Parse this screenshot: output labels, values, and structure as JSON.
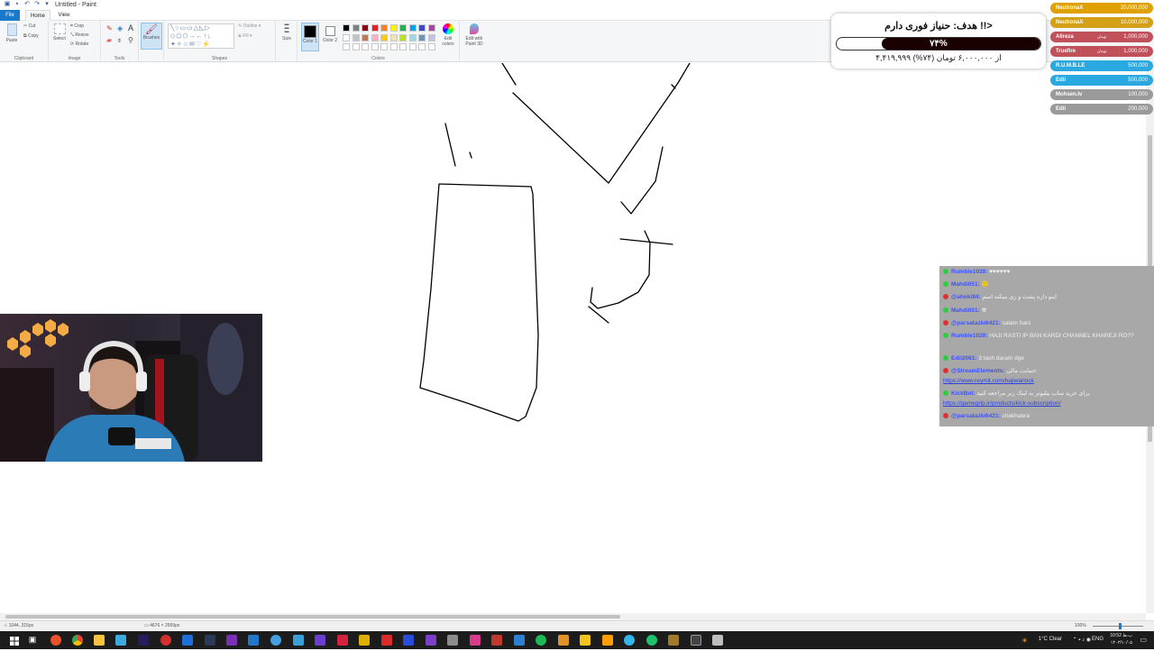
{
  "window": {
    "title": "Untitled - Paint"
  },
  "tabs": [
    {
      "label": "File"
    },
    {
      "label": "Home"
    },
    {
      "label": "View"
    }
  ],
  "ribbon": {
    "groups": [
      {
        "name": "Clipboard"
      },
      {
        "name": "Image"
      },
      {
        "name": "Tools"
      },
      {
        "name": "Shapes"
      },
      {
        "name": "Colors"
      }
    ],
    "buttons": {
      "paste": "Paste",
      "cut": "Cut",
      "copy": "Copy",
      "select": "Select",
      "crop": "Crop",
      "resize": "Resize",
      "rotate": "Rotate",
      "brushes": "Brushes",
      "outline": "Outline",
      "fill": "Fill",
      "size": "Size",
      "color1": "Color 1",
      "color2": "Color 2",
      "edit_colors": "Edit colors",
      "edit_paint3d": "Edit with Paint 3D"
    },
    "palette": [
      "#000000",
      "#7f7f7f",
      "#880015",
      "#ed1c24",
      "#ff7f27",
      "#fff200",
      "#22b14c",
      "#00a2e8",
      "#3f48cc",
      "#a349a4",
      "#ffffff",
      "#c3c3c3",
      "#b97a57",
      "#ffaec9",
      "#ffc90e",
      "#efe4b0",
      "#b5e61d",
      "#99d9ea",
      "#7092be",
      "#c8bfe7"
    ],
    "color1": "#000000",
    "color2": "#ffffff"
  },
  "status": {
    "position": "1044, 315px",
    "canvas_size": "4676 × 2569px",
    "zoom": "100%"
  },
  "tray": {
    "weather": "1°C  Clear",
    "lang": "ENG",
    "time": "10:52 ب.ظ",
    "date": "۱۴۰۳/۱۰/۰۵"
  },
  "donation_goal": {
    "title": "هدف: حنیاز فوری دارم !!>",
    "percent_label": "۷۴%",
    "percent": 74,
    "subtitle": "۴,۴۱۹,۹۹۹ از ۶,۰۰۰,۰۰۰ تومان (۷۴%)"
  },
  "donors": [
    {
      "name": "NeutronaX",
      "amount": "20,000,000",
      "color": "#e0a100",
      "tag": ""
    },
    {
      "name": "NeutronaX",
      "amount": "10,000,000",
      "color": "#d4a017",
      "tag": ""
    },
    {
      "name": "Alireza",
      "amount": "1,000,000",
      "color": "#c0505a",
      "tag": "تومان"
    },
    {
      "name": "Truefire",
      "amount": "1,000,000",
      "color": "#c0505a",
      "tag": "تومان"
    },
    {
      "name": "R.U.M.B.LE",
      "amount": "500,000",
      "color": "#2aa9e0",
      "tag": ""
    },
    {
      "name": "Edii",
      "amount": "500,000",
      "color": "#2aa9e0",
      "tag": ""
    },
    {
      "name": "Mohsen.Iv",
      "amount": "100,000",
      "color": "#9a9a9a",
      "tag": ""
    },
    {
      "name": "Edii",
      "amount": "200,000",
      "color": "#9a9a9a",
      "tag": ""
    }
  ],
  "chat": [
    {
      "user": "Rumble1020:",
      "msg": "♥♥♥♥♥♥",
      "badge": "#2ecc40"
    },
    {
      "user": "Mahdi051:",
      "msg": "🙂",
      "badge": "#2ecc40"
    },
    {
      "user": "@ahoki84:",
      "msg": "اینو داره پشت و ری میکنه اسم",
      "badge": "#e03131"
    },
    {
      "user": "Mahdi051:",
      "msg": "☢",
      "badge": "#2ecc40"
    },
    {
      "user": "@parsatazki6421:",
      "msg": "salam hani",
      "badge": "#e03131"
    },
    {
      "user": "Rumble1020:",
      "msg": "HAJI RASTI IP BAN KARDI CHANNEL KHAREJI RO??",
      "badge": "#2ecc40"
    },
    {
      "user": "Edii2081:",
      "msg": "3 tash daram dge",
      "badge": "#2ecc40"
    },
    {
      "user": "@StreamElements:",
      "msg": "حمایت مالی:",
      "badge": "#e03131"
    },
    {
      "user": "",
      "msg": "https://www.reymit.com/hajiwarlock",
      "badge": ""
    },
    {
      "user": "KickBot:",
      "msg": "برای خرید ساب بیلیونر به لینک زیر مراجعه کنید",
      "badge": "#2ecc40"
    },
    {
      "user": "",
      "msg": "https://gamegrip.ir/products/kick-subscription/",
      "badge": ""
    },
    {
      "user": "@parsatazki6421:",
      "msg": "chekhabra",
      "badge": "#e03131"
    }
  ]
}
